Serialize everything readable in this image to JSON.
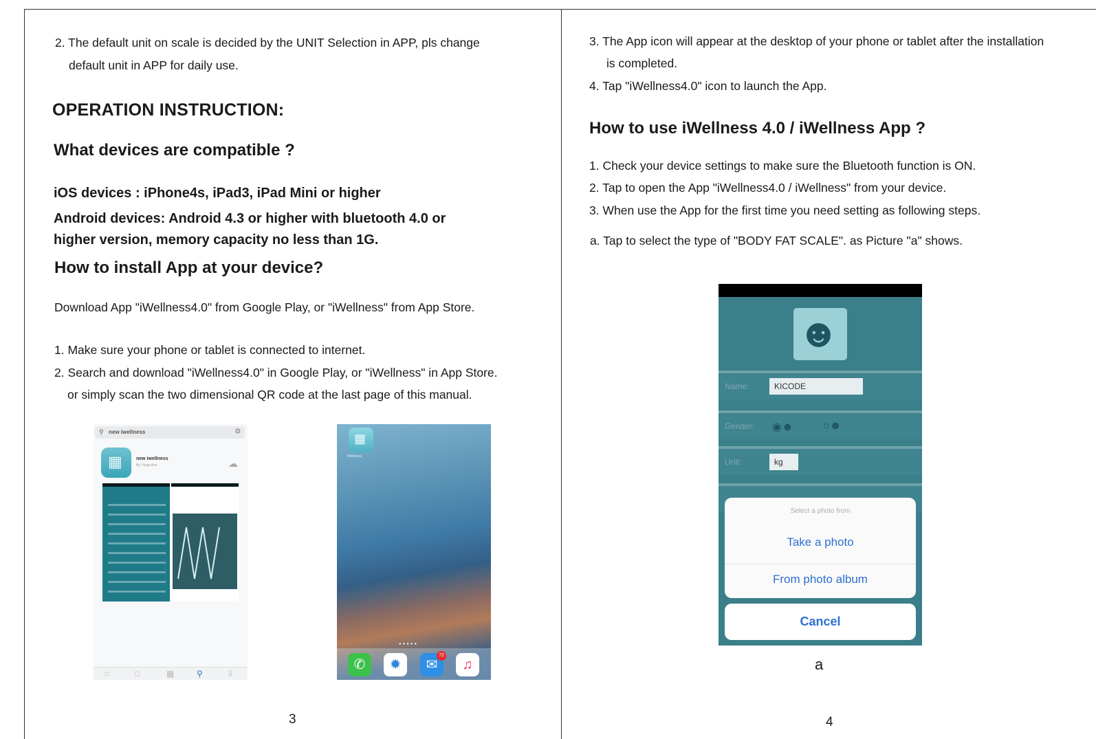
{
  "left_page": {
    "item_2_line1": "2. The default unit on scale is decided by the UNIT Selection in APP, pls change",
    "item_2_line2": "default unit in APP for daily use.",
    "operation_title": "OPERATION INSTRUCTION:",
    "compatible_title": "What devices are compatible ?",
    "ios_devices": "iOS devices : iPhone4s, iPad3, iPad Mini or higher",
    "android_line1": "Android devices: Android 4.3 or higher with bluetooth 4.0 or",
    "android_line2": "higher version, memory capacity no less than 1G.",
    "install_title": "How to install App at your device?",
    "download_text": "Download App \"iWellness4.0\" from Google Play, or \"iWellness\" from App Store.",
    "step_1": "1. Make sure your phone or tablet is connected to internet.",
    "step_2_line1": "2. Search and download \"iWellness4.0\" in Google Play, or \"iWellness\" in App Store.",
    "step_2_line2": "or simply scan the two dimensional QR code at the last page of this manual.",
    "page_number": "3"
  },
  "store_screenshot": {
    "search_text": "new iwellness",
    "app_name": "new iwellness",
    "developer": "By: Hugo Ann",
    "icon": "app-icon",
    "tab_icons": [
      "star-icon",
      "calendar-icon",
      "grid-icon",
      "search-icon",
      "download-icon"
    ]
  },
  "home_screenshot": {
    "app_label": "iWellness",
    "mail_badge": "72",
    "dock_icons": [
      "phone-icon",
      "safari-icon",
      "mail-icon",
      "music-icon"
    ]
  },
  "right_page": {
    "item_3_line1": "3. The App icon will appear at the desktop of your phone or tablet after the installation",
    "item_3_line2": "is completed.",
    "item_4": "4. Tap \"iWellness4.0\" icon to launch the App.",
    "howto_title": "How to use iWellness 4.0 / iWellness App ?",
    "use_step_1": "1. Check your device settings to make sure the Bluetooth function is ON.",
    "use_step_2": "2. Tap to open the App \"iWellness4.0 / iWellness\" from your device.",
    "use_step_3": "3. When use the App for the first time you need setting as following steps.",
    "use_step_a": "a. Tap to select the type of \"BODY FAT SCALE\". as Picture \"a\" shows.",
    "figure_caption": "a",
    "page_number": "4"
  },
  "profile_screenshot": {
    "name_label": "Name:",
    "name_value": "KICODE",
    "gender_label": "Gender:",
    "unit_label": "Unit:",
    "unit_value": "kg",
    "sheet_title": "Select a photo from",
    "take_photo": "Take a photo",
    "photo_album": "From photo album",
    "cancel": "Cancel"
  },
  "colors": {
    "app_teal": "#3a7f8a",
    "ios_blue": "#2f6fd0",
    "text": "#1a1a1a"
  }
}
